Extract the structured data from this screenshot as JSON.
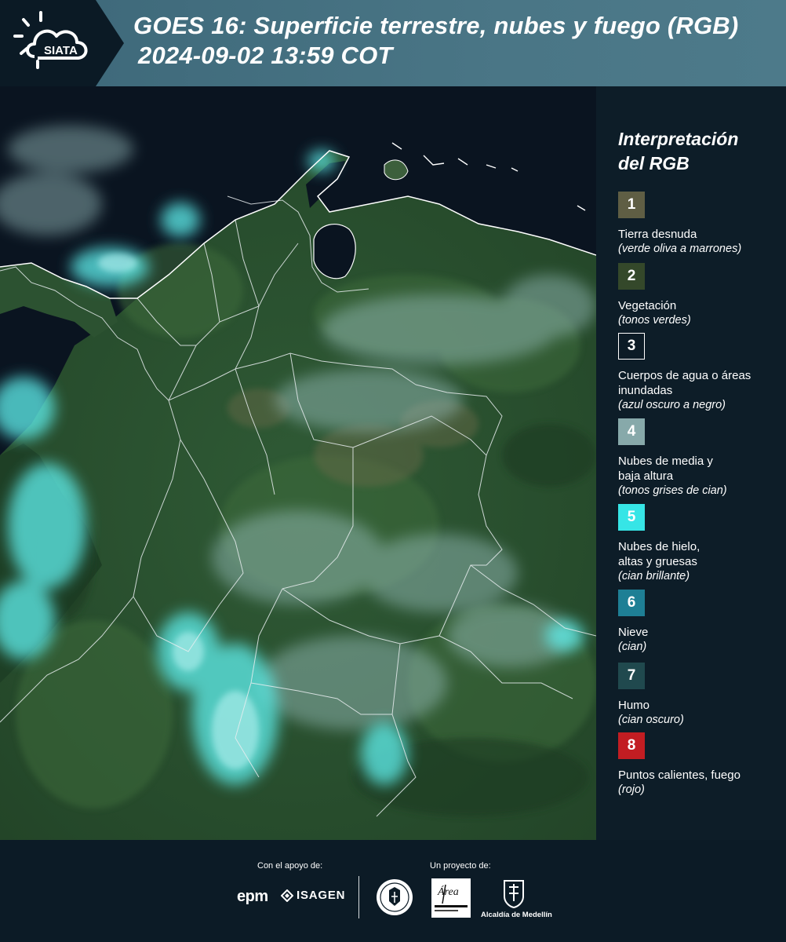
{
  "header": {
    "title": "GOES 16: Superficie terrestre, nubes y fuego (RGB)",
    "timestamp": "2024-09-02 13:59 COT",
    "logo_text": "SIATA"
  },
  "legend": {
    "title_line1": "Interpretación",
    "title_line2": "del RGB",
    "items": [
      {
        "number": "1",
        "label": "Tierra desnuda",
        "desc": "(verde oliva a marrones)",
        "color": "#5f5e44"
      },
      {
        "number": "2",
        "label": "Vegetación",
        "desc": "(tonos verdes)",
        "color": "#34482a"
      },
      {
        "number": "3",
        "label": "Cuerpos de agua o áreas inundadas",
        "desc": "(azul oscuro a negro)",
        "color": "#0c1b26"
      },
      {
        "number": "4",
        "label": "Nubes de media y baja altura",
        "desc": "(tonos grises de cian)",
        "color": "#87a9aa"
      },
      {
        "number": "5",
        "label": "Nubes de hielo, altas y gruesas",
        "desc": "(cian brillante)",
        "color": "#36e5e6"
      },
      {
        "number": "6",
        "label": "Nieve",
        "desc": "(cian)",
        "color": "#1e7f95"
      },
      {
        "number": "7",
        "label": "Humo",
        "desc": "(cian oscuro)",
        "color": "#20494e"
      },
      {
        "number": "8",
        "label": "Puntos calientes, fuego",
        "desc": "(rojo)",
        "color": "#c21d22"
      }
    ]
  },
  "footer": {
    "support_caption": "Con el apoyo de:",
    "project_caption": "Un proyecto de:",
    "sponsor_epm": "epm",
    "sponsor_isagen": "ISAGEN",
    "area_logo_text": "Área",
    "alcaldia": "Alcaldía de Medellín"
  }
}
